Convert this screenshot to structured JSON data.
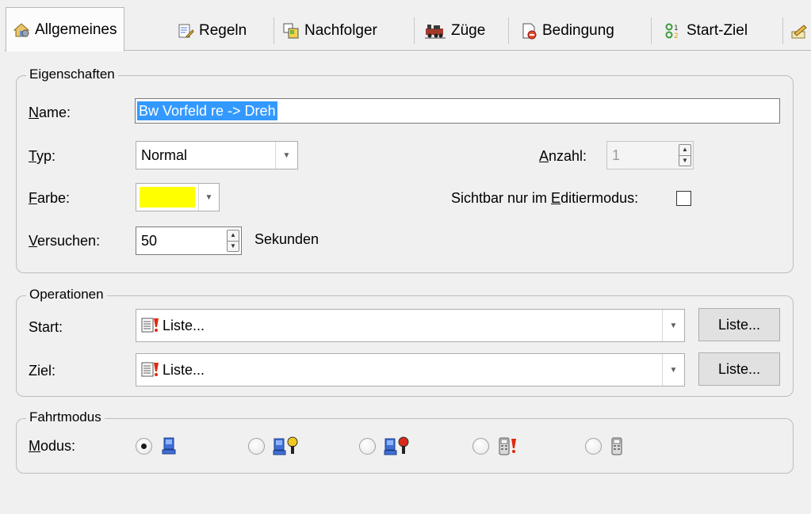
{
  "tabs": [
    {
      "label": "Allgemeines",
      "icon": "house-settings-icon",
      "active": true
    },
    {
      "label": "Regeln",
      "icon": "rules-icon",
      "active": false
    },
    {
      "label": "Nachfolger",
      "icon": "successor-icon",
      "active": false
    },
    {
      "label": "Züge",
      "icon": "train-icon",
      "active": false
    },
    {
      "label": "Bedingung",
      "icon": "condition-icon",
      "active": false
    },
    {
      "label": "Start-Ziel",
      "icon": "start-goal-icon",
      "active": false
    }
  ],
  "eigenschaften": {
    "legend": "Eigenschaften",
    "name": {
      "label_u": "N",
      "label_rest": "ame:",
      "value": "Bw Vorfeld re -> Dreh"
    },
    "typ": {
      "label_u": "T",
      "label_rest": "yp:",
      "value": "Normal"
    },
    "farbe": {
      "label_u": "F",
      "label_rest": "arbe:",
      "color": "#ffff00"
    },
    "versuchen": {
      "label_u": "V",
      "label_rest": "ersuchen:",
      "value": "50",
      "unit": "Sekunden"
    },
    "anzahl": {
      "label_u": "A",
      "label_rest": "nzahl:",
      "value": "1"
    },
    "sichtbar": {
      "label_pre": "Sichtbar nur im ",
      "label_u": "E",
      "label_rest": "ditiermodus:",
      "checked": false
    }
  },
  "operationen": {
    "legend": "Operationen",
    "start": {
      "label": "Start:",
      "value": "Liste...",
      "button": "Liste..."
    },
    "ziel": {
      "label": "Ziel:",
      "value": "Liste...",
      "button": "Liste..."
    }
  },
  "fahrtmodus": {
    "legend": "Fahrtmodus",
    "modus_label_u": "M",
    "modus_label_rest": "odus:",
    "options": [
      {
        "icon": "computer-icon",
        "checked": true
      },
      {
        "icon": "computer-yellow-signal-icon",
        "checked": false
      },
      {
        "icon": "computer-red-signal-icon",
        "checked": false
      },
      {
        "icon": "handheld-red-icon",
        "checked": false
      },
      {
        "icon": "handheld-icon",
        "checked": false
      }
    ]
  },
  "colors": {
    "accent": "#3399ff",
    "farbe": "#ffff00"
  }
}
